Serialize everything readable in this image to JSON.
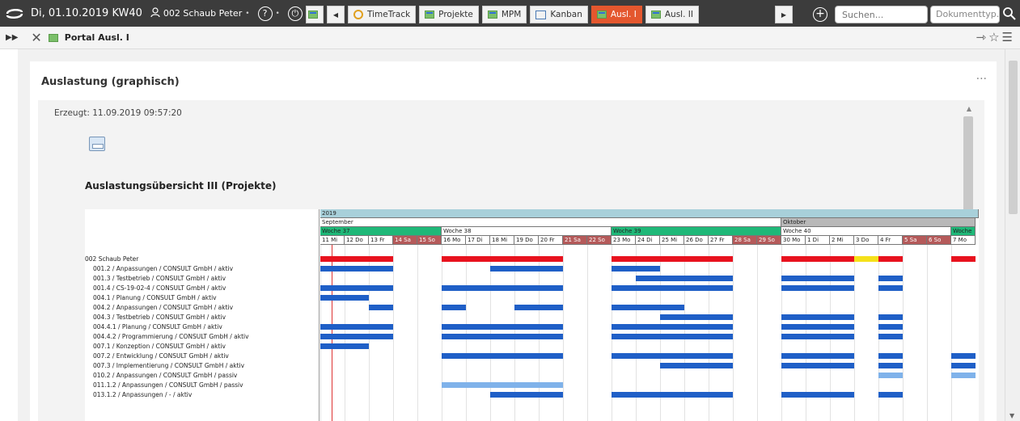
{
  "topbar": {
    "date_text": "Di, 01.10.2019 KW40",
    "user": "002 Schaub Peter",
    "help_label": "?",
    "power_label": "⏻",
    "tabs": [
      {
        "label": "",
        "icon": "grid-icon",
        "kind": "small"
      },
      {
        "label": "TimeTrack",
        "icon": "clock-icon"
      },
      {
        "label": "Projekte",
        "icon": "grid-icon"
      },
      {
        "label": "MPM",
        "icon": "grid-icon"
      },
      {
        "label": "Kanban",
        "icon": "calendar-icon"
      },
      {
        "label": "Ausl. I",
        "icon": "grid-icon",
        "active": true
      },
      {
        "label": "Ausl. II",
        "icon": "grid-icon"
      }
    ],
    "search_placeholder": "Suchen...",
    "doctype_placeholder": "Dokumenttyp."
  },
  "bar2": {
    "title": "Portal Ausl. I"
  },
  "card": {
    "title": "Auslastung (graphisch)",
    "erzeugt": "Erzeugt: 11.09.2019 09:57:20",
    "overview_title": "Auslastungsübersicht III (Projekte)"
  },
  "gantt": {
    "year": "2019",
    "months": [
      "September",
      "Oktober"
    ],
    "weeks": [
      "Woche 37",
      "Woche 38",
      "Woche 39",
      "Woche 40",
      "Woche"
    ],
    "days": [
      "11 Mi",
      "12 Do",
      "13 Fr",
      "14 Sa",
      "15 So",
      "16 Mo",
      "17 Di",
      "18 Mi",
      "19 Do",
      "20 Fr",
      "21 Sa",
      "22 So",
      "23 Mo",
      "24 Di",
      "25 Mi",
      "26 Do",
      "27 Fr",
      "28 Sa",
      "29 So",
      "30 Mo",
      "1 Di",
      "2 Mi",
      "3 Do",
      "4 Fr",
      "5 Sa",
      "6 So",
      "7 Mo"
    ],
    "rows": [
      "002 Schaub Peter",
      "001.2 / Anpassungen / CONSULT GmbH / aktiv",
      "001.3 / Testbetrieb / CONSULT GmbH / aktiv",
      "001.4 / CS-19-02-4 / CONSULT GmbH / aktiv",
      "004.1 / Planung / CONSULT GmbH / aktiv",
      "004.2 / Anpassungen / CONSULT GmbH / aktiv",
      "004.3 / Testbetrieb / CONSULT GmbH / aktiv",
      "004.4.1 / Planung / CONSULT GmbH / aktiv",
      "004.4.2 / Programmierung / CONSULT GmbH / aktiv",
      "007.1 / Konzeption / CONSULT GmbH / aktiv",
      "007.2 / Entwicklung / CONSULT GmbH / aktiv",
      "007.3 / Implementierung / CONSULT GmbH / aktiv",
      "010.2 / Anpassungen / CONSULT GmbH / passiv",
      "011.1.2 / Anpassungen / CONSULT GmbH / passiv",
      "013.1.2 / Anpassungen / - / aktiv"
    ],
    "colors": {
      "blue": "#1f5fc7",
      "light_blue": "#7fb2ea",
      "red": "#e8121e",
      "yellow": "#f5e11a",
      "green_week": "#1fb878",
      "weekend": "#b55a5a",
      "year_band": "#a8d0da",
      "month_oct": "#b8b8b8"
    }
  }
}
